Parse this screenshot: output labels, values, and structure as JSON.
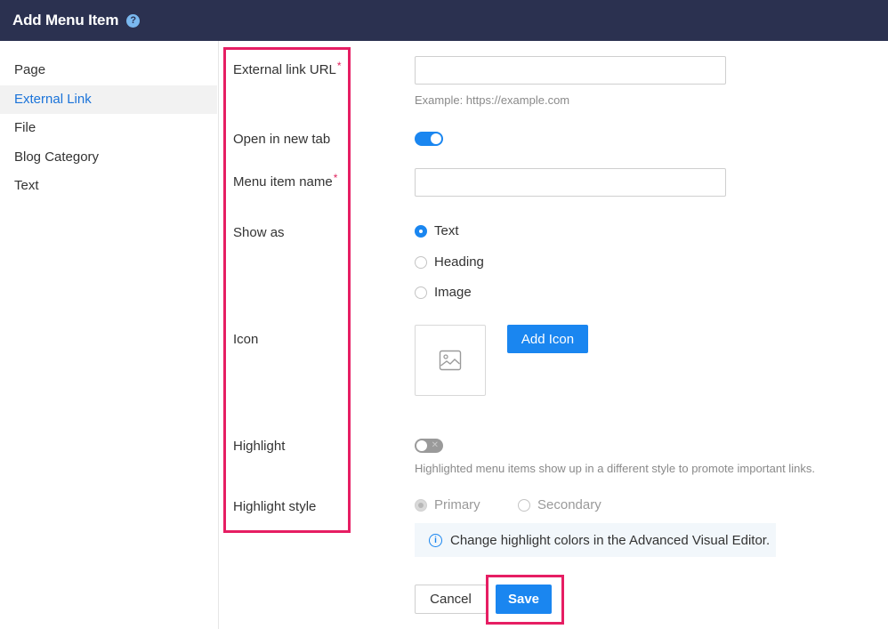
{
  "header": {
    "title": "Add Menu Item",
    "help_icon": "?"
  },
  "sidebar": {
    "items": [
      {
        "label": "Page"
      },
      {
        "label": "External Link",
        "active": true
      },
      {
        "label": "File"
      },
      {
        "label": "Blog Category"
      },
      {
        "label": "Text"
      }
    ]
  },
  "form": {
    "external_url": {
      "label": "External link URL",
      "required": "*",
      "value": "",
      "hint": "Example: https://example.com"
    },
    "open_new_tab": {
      "label": "Open in new tab",
      "on": true
    },
    "menu_item_name": {
      "label": "Menu item name",
      "required": "*",
      "value": ""
    },
    "show_as": {
      "label": "Show as",
      "options": [
        {
          "label": "Text",
          "checked": true
        },
        {
          "label": "Heading",
          "checked": false
        },
        {
          "label": "Image",
          "checked": false
        }
      ]
    },
    "icon": {
      "label": "Icon",
      "add_button": "Add Icon"
    },
    "highlight": {
      "label": "Highlight",
      "on": false,
      "toggle_mark": "✕",
      "hint": "Highlighted menu items show up in a different style to promote important links."
    },
    "highlight_style": {
      "label": "Highlight style",
      "options": [
        {
          "label": "Primary",
          "checked": true
        },
        {
          "label": "Secondary",
          "checked": false
        }
      ],
      "info_icon": "i",
      "info": "Change highlight colors in the Advanced Visual Editor."
    }
  },
  "actions": {
    "cancel": "Cancel",
    "save": "Save"
  },
  "colors": {
    "header_bg": "#2b3150",
    "accent": "#1a86f0",
    "annotation": "#e61e63"
  }
}
